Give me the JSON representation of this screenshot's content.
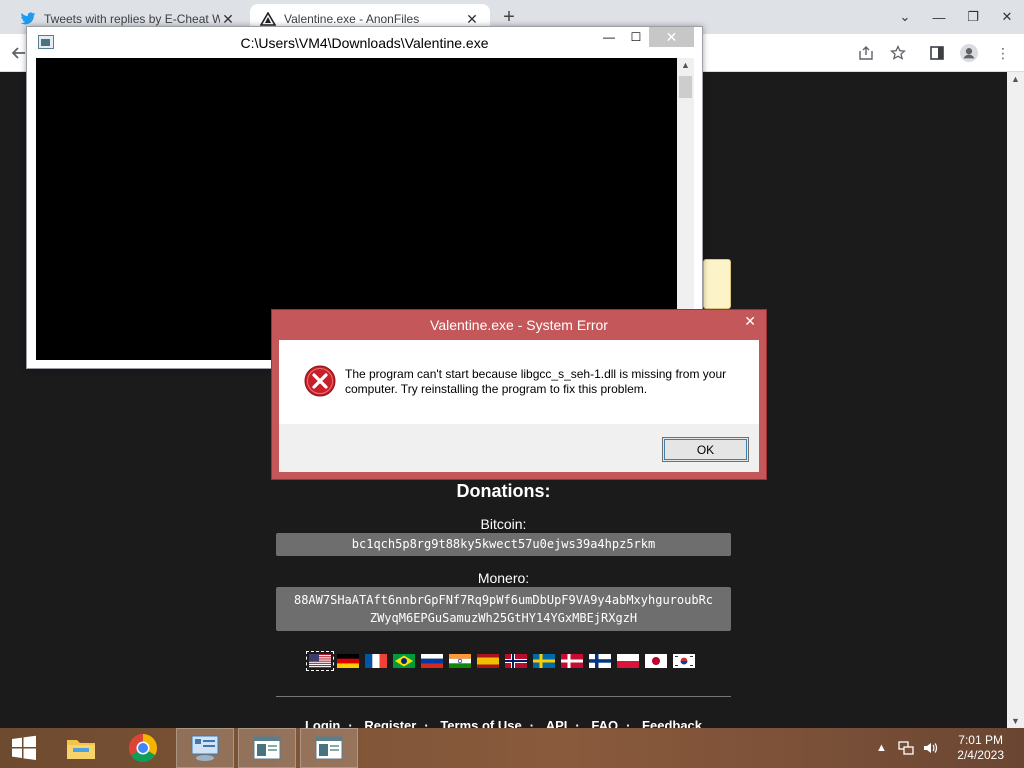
{
  "browser": {
    "tabs": [
      {
        "title": "Tweets with replies by E-Cheat W",
        "icon": "twitter-icon",
        "active": false
      },
      {
        "title": "Valentine.exe - AnonFiles",
        "icon": "anonfiles-icon",
        "active": true
      }
    ],
    "new_tab": "+"
  },
  "page": {
    "donations_title": "Donations:",
    "bitcoin_label": "Bitcoin:",
    "bitcoin_address": "bc1qch5p8rg9t88ky5kwect57u0ejws39a4hpz5rkm",
    "monero_label": "Monero:",
    "monero_address_1": "88AW7SHaATAft6nnbrGpFNf7Rq9pWf6umDbUpF9VA9y4abMxyhguroubRc",
    "monero_address_2": "ZWyqM6EPGuSamuzWh25GtHY14YGxMBEjRXgzH",
    "footer_links": [
      "Login",
      "Register",
      "Terms of Use",
      "API",
      "FAQ",
      "Feedback"
    ],
    "footer_separator": "·",
    "flags": [
      "us",
      "de",
      "fr",
      "br",
      "ru",
      "in",
      "es",
      "no",
      "se",
      "dk",
      "fi",
      "pl",
      "jp",
      "kr"
    ]
  },
  "console_window": {
    "title": "C:\\Users\\VM4\\Downloads\\Valentine.exe"
  },
  "error_dialog": {
    "title": "Valentine.exe - System Error",
    "message_line1": "The program can't start because libgcc_s_seh-1.dll is missing from your",
    "message_line2": "computer. Try reinstalling the program to fix this problem.",
    "ok_label": "OK"
  },
  "taskbar": {
    "time": "7:01 PM",
    "date": "2/4/2023"
  }
}
